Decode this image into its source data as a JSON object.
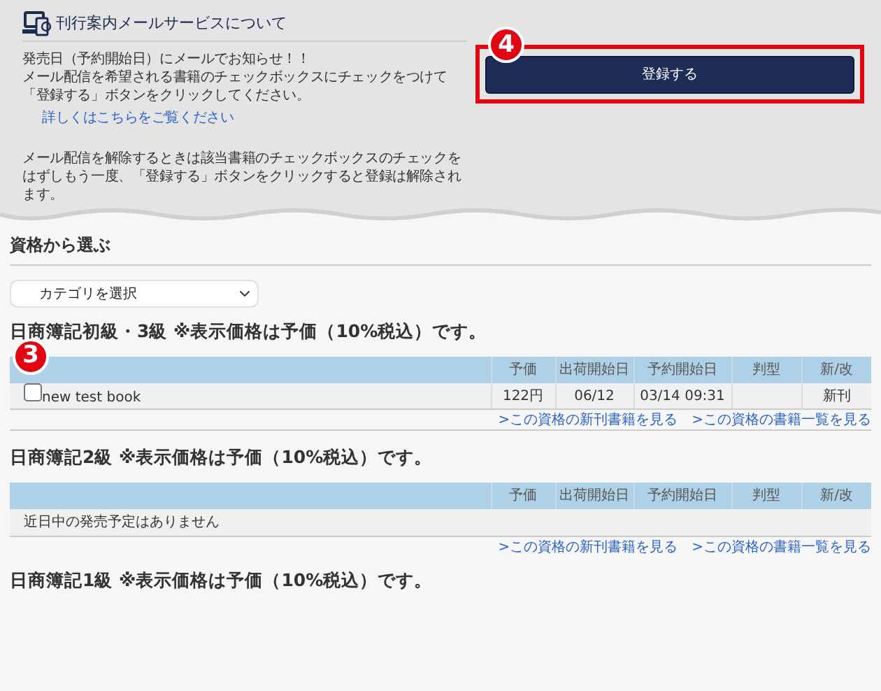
{
  "notice": {
    "title": "刊行案内メールサービスについて",
    "lines": [
      "発売日（予約開始日）にメールでお知らせ！！",
      "メール配信を希望される書籍のチェックボックスにチェックをつけて「登録する」ボタンをクリックしてください。"
    ],
    "detail_link": "詳しくはこちらをご覧ください",
    "unsubscribe_note": "メール配信を解除するときは該当書籍のチェックボックスのチェックをはずしもう一度、「登録する」ボタンをクリックすると登録は解除されます。"
  },
  "register_button": {
    "label": "登録する",
    "highlighted": true,
    "marker": "4"
  },
  "category": {
    "title": "資格から選ぶ",
    "select_value": "カテゴリを選択"
  },
  "sections": [
    {
      "heading": "日商簿記初級・3級 ※表示価格は予価（10%税込）です。",
      "marker": "3",
      "columns": [
        "予価",
        "出荷開始日",
        "予約開始日",
        "判型",
        "新/改"
      ],
      "rows": [
        {
          "kind": "book",
          "checked": false,
          "title": "new test book",
          "price": "122円",
          "ship_date": "06/12",
          "reserve_date": "03/14 09:31",
          "status": "新刊"
        }
      ],
      "links": [
        ">この資格の新刊書籍を見る",
        ">この資格の書籍一覧を見る"
      ]
    },
    {
      "heading": "日商簿記2級 ※表示価格は予価（10%税込）です。",
      "columns": [
        "予価",
        "出荷開始日",
        "予約開始日",
        "判型",
        "新/改"
      ],
      "rows": [
        {
          "kind": "empty",
          "message": "近日中の発売予定はありません"
        }
      ],
      "links": [
        ">この資格の新刊書籍を見る",
        ">この資格の書籍一覧を見る"
      ]
    },
    {
      "heading": "日商簿記1級 ※表示価格は予価（10%税込）です。"
    }
  ]
}
